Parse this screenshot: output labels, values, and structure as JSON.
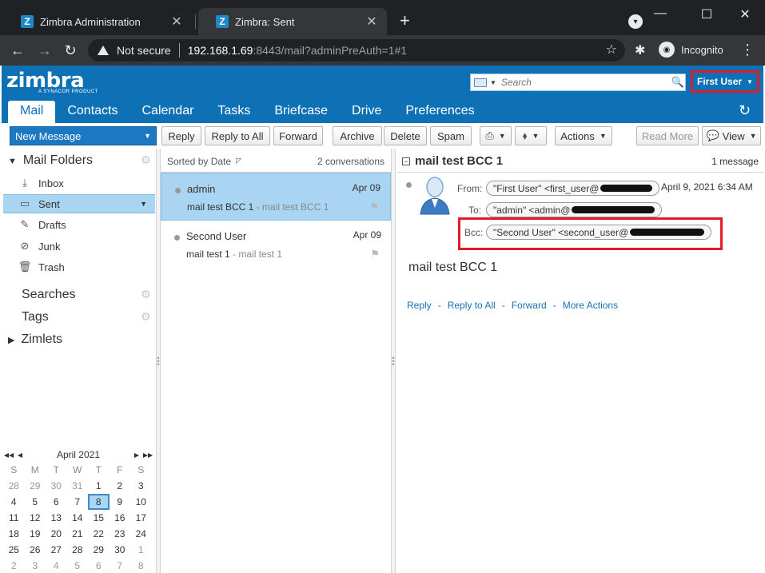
{
  "browser": {
    "tabs": [
      {
        "title": "Zimbra Administration",
        "favicon": "Z"
      },
      {
        "title": "Zimbra: Sent",
        "favicon": "Z"
      }
    ],
    "new_tab": "+",
    "url_security": "Not secure",
    "url_host": "192.168.1.69",
    "url_rest": ":8443/mail?adminPreAuth=1#1",
    "profile": "Incognito",
    "colors": {
      "chrome_dark": "#202124",
      "chrome_toolbar": "#35363a"
    }
  },
  "zimbra": {
    "logo": "zimbra",
    "logo_sub": "A SYNACOR PRODUCT",
    "search_placeholder": "Search",
    "user_menu": "First User",
    "app_tabs": [
      "Mail",
      "Contacts",
      "Calendar",
      "Tasks",
      "Briefcase",
      "Drive",
      "Preferences"
    ],
    "active_tab": "Mail",
    "colors": {
      "header_blue": "#0f71b5",
      "selection": "#a9d4f2",
      "highlight_red": "#e01b2b"
    }
  },
  "toolbar": {
    "new_message": "New Message",
    "reply": "Reply",
    "reply_all": "Reply to All",
    "forward": "Forward",
    "archive": "Archive",
    "delete": "Delete",
    "spam": "Spam",
    "actions": "Actions",
    "read_more": "Read More",
    "view": "View"
  },
  "sidebar": {
    "mail_folders": "Mail Folders",
    "folders": [
      {
        "label": "Inbox",
        "icon": "inbox-icon"
      },
      {
        "label": "Sent",
        "icon": "sent-icon"
      },
      {
        "label": "Drafts",
        "icon": "drafts-icon"
      },
      {
        "label": "Junk",
        "icon": "junk-icon"
      },
      {
        "label": "Trash",
        "icon": "trash-icon"
      }
    ],
    "searches": "Searches",
    "tags": "Tags",
    "zimlets": "Zimlets"
  },
  "calendar": {
    "title": "April 2021",
    "dow": [
      "S",
      "M",
      "T",
      "W",
      "T",
      "F",
      "S"
    ],
    "weeks": [
      [
        "28",
        "29",
        "30",
        "31",
        "1",
        "2",
        "3"
      ],
      [
        "4",
        "5",
        "6",
        "7",
        "8",
        "9",
        "10"
      ],
      [
        "11",
        "12",
        "13",
        "14",
        "15",
        "16",
        "17"
      ],
      [
        "18",
        "19",
        "20",
        "21",
        "22",
        "23",
        "24"
      ],
      [
        "25",
        "26",
        "27",
        "28",
        "29",
        "30",
        "1"
      ],
      [
        "2",
        "3",
        "4",
        "5",
        "6",
        "7",
        "8"
      ]
    ],
    "today": "8"
  },
  "list": {
    "sort_label": "Sorted by Date",
    "count": "2 conversations",
    "conversations": [
      {
        "from": "admin",
        "date": "Apr 09",
        "subject": "mail test BCC 1",
        "fragment": " - mail test BCC 1"
      },
      {
        "from": "Second User",
        "date": "Apr 09",
        "subject": "mail test 1",
        "fragment": " - mail test 1"
      }
    ]
  },
  "reading": {
    "subject": "mail test BCC 1",
    "count": "1 message",
    "from_label": "From:",
    "from_value": "\"First User\" <first_user@",
    "to_label": "To:",
    "to_value": "\"admin\" <admin@",
    "bcc_label": "Bcc:",
    "bcc_value": "\"Second User\" <second_user@",
    "date": "April 9, 2021 6:34 AM",
    "body": "mail test BCC 1",
    "actions": {
      "reply": "Reply",
      "reply_all": "Reply to All",
      "forward": "Forward",
      "more": "More Actions"
    }
  }
}
